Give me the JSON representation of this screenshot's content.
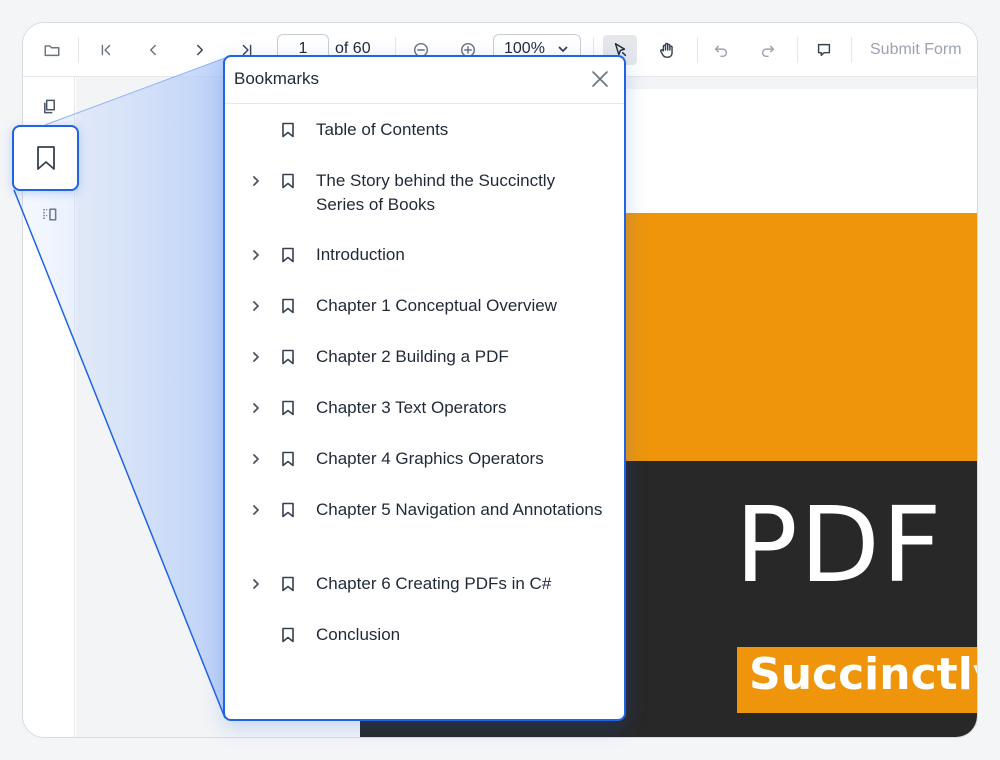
{
  "toolbar": {
    "current_page": "1",
    "page_of": "of 60",
    "zoom_level": "100%",
    "submit_label": "Submit Form"
  },
  "bookmarks_panel": {
    "title": "Bookmarks",
    "items": [
      {
        "label": "Table of Contents",
        "expandable": false
      },
      {
        "label": "The Story behind the Succinctly Series of Books",
        "expandable": true
      },
      {
        "label": "Introduction",
        "expandable": true
      },
      {
        "label": "Chapter 1 Conceptual Overview",
        "expandable": true
      },
      {
        "label": "Chapter 2 Building a PDF",
        "expandable": true
      },
      {
        "label": "Chapter 3 Text Operators",
        "expandable": true
      },
      {
        "label": "Chapter 4 Graphics Operators",
        "expandable": true
      },
      {
        "label": "Chapter 5 Navigation and Annotations",
        "expandable": true
      },
      {
        "label": "Chapter 6 Creating PDFs in C#",
        "expandable": true
      },
      {
        "label": "Conclusion",
        "expandable": false
      }
    ]
  },
  "document": {
    "cover_title": "PDF",
    "cover_subtitle": "Succinctly"
  },
  "colors": {
    "accent": "#1f63e6",
    "cover_orange": "#ee950c",
    "cover_dark": "#282828"
  },
  "icons": {
    "toolbar": [
      "folder-open-icon",
      "first-page-icon",
      "previous-page-icon",
      "next-page-icon",
      "last-page-icon",
      "zoom-out-icon",
      "zoom-in-icon",
      "chevron-down-icon",
      "selection-arrow-icon",
      "pan-hand-icon",
      "undo-icon",
      "redo-icon",
      "comment-icon"
    ],
    "rail": [
      "page-thumbnails-icon",
      "bookmark-icon",
      "organize-pages-icon"
    ]
  }
}
